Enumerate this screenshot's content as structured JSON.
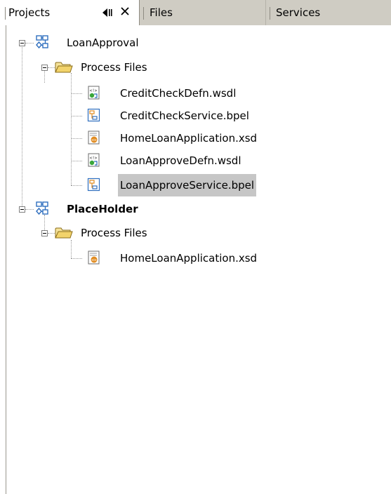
{
  "tabs": [
    {
      "label": "Projects",
      "active": true
    },
    {
      "label": "Files",
      "active": false
    },
    {
      "label": "Services",
      "active": false
    }
  ],
  "tab_buttons": {
    "minimize": "◀‖",
    "close": "✕"
  },
  "tree": {
    "projects": [
      {
        "name": "LoanApproval",
        "bold": false,
        "folder": "Process Files",
        "files": [
          {
            "name": "CreditCheckDefn.wsdl",
            "type": "wsdl"
          },
          {
            "name": "CreditCheckService.bpel",
            "type": "bpel"
          },
          {
            "name": "HomeLoanApplication.xsd",
            "type": "xsd"
          },
          {
            "name": "LoanApproveDefn.wsdl",
            "type": "wsdl"
          },
          {
            "name": "LoanApproveService.bpel",
            "type": "bpel",
            "selected": true
          }
        ]
      },
      {
        "name": "PlaceHolder",
        "bold": true,
        "folder": "Process Files",
        "files": [
          {
            "name": "HomeLoanApplication.xsd",
            "type": "xsd"
          }
        ]
      }
    ]
  },
  "colors": {
    "tab_bar": "#cfccc3",
    "selection": "#c6c6c6",
    "folder": "#f2d36b",
    "project_icon": "#2f6fbf",
    "bpel_icon": "#e08a1e"
  }
}
